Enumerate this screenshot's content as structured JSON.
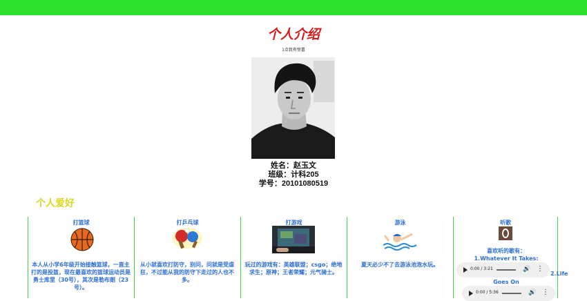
{
  "page": {
    "title": "个人介绍",
    "photo_caption": "1点我有惊喜",
    "info": {
      "name": "姓名：赵玉文",
      "class": "班级：计科205",
      "id": "学号：20101080519"
    },
    "hobbies_title": "个人爱好"
  },
  "hobbies": [
    {
      "title": "打篮球",
      "icon": "basketball-icon",
      "text": "本人从小学6年级开始接触篮球，一直主打的是投篮，现在最喜欢的篮球运动员是勇士库里（30号），其次是勒布朗（23号）。"
    },
    {
      "title": "打乒乓球",
      "icon": "ping-pong-icon",
      "text": "从小就喜欢打防守，别问，问就是受虐狂，不过能从我的防守下走过的人也不多。"
    },
    {
      "title": "打游戏",
      "icon": "gaming-icon",
      "text": "玩过的游戏有：英雄联盟；csgo；绝地求生；原神；王者荣耀；元气骑士。"
    },
    {
      "title": "游泳",
      "icon": "swimming-icon",
      "text": "夏天必少不了去游泳池泡水玩。"
    },
    {
      "title": "听歌",
      "icon": "music-icon",
      "songs_label": "喜欢听的歌有：",
      "song1": "1.Whatever It Takes:",
      "song2_a": "2.Life",
      "song2_b": "Goes On",
      "audio1_time": "0:00 / 3:21",
      "audio2_time": "0:00 / 5:36"
    }
  ],
  "colors": {
    "topbar": "#2ee02e",
    "title": "#d21c1c",
    "hobbies_title": "#d8d820",
    "column_text": "#2d6fd6",
    "column_border": "#3bd83b"
  }
}
